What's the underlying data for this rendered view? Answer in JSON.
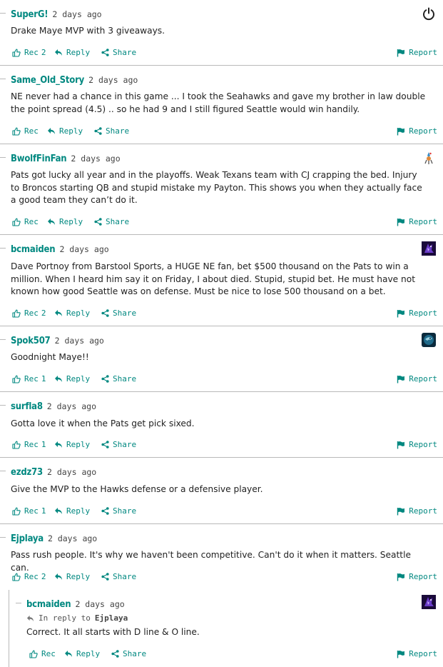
{
  "actions": {
    "rec": "Rec",
    "reply": "Reply",
    "share": "Share",
    "report": "Report"
  },
  "in_reply_to_label": "In reply to",
  "comments": [
    {
      "author": "SuperG!",
      "time": "2 days ago",
      "text": "Drake Maye MVP with 3 giveaways.",
      "rec_count": "2",
      "avatar": "power-icon"
    },
    {
      "author": "Same_Old_Story",
      "time": "2 days ago",
      "text": "NE never had a chance in this game ... I took the Seahawks and gave my brother in law double the point spread (4.5) .. so he had 9 and I still figured Seattle would win handily.",
      "rec_count": ""
    },
    {
      "author": "BwolfFinFan",
      "time": "2 days ago",
      "text": "Pats got lucky all year and in the playoffs. Weak Texans team with CJ crapping the bed. Injury to Broncos starting QB and stupid mistake my Payton. This shows you when they actually face a good team they can’t do it.",
      "rec_count": "",
      "avatar": "mascot-avatar"
    },
    {
      "author": "bcmaiden",
      "time": "2 days ago",
      "text": "Dave Portnoy from Barstool Sports, a HUGE NE fan, bet $500 thousand on the Pats to win a million. When I heard him say it on Friday, I about died. Stupid, stupid bet. He must have not known how good Seattle was on defense. Must be nice to lose 500 thousand on a bet.",
      "rec_count": "2",
      "avatar": "purple-avatar"
    },
    {
      "author": "Spok507",
      "time": "2 days ago",
      "text": "Goodnight Maye!!",
      "rec_count": "1",
      "avatar": "seahawks-avatar"
    },
    {
      "author": "surfla8",
      "time": "2 days ago",
      "text": "Gotta love it when the Pats get pick sixed.",
      "rec_count": "1"
    },
    {
      "author": "ezdz73",
      "time": "2 days ago",
      "text": "Give the MVP to the Hawks defense or a defensive player.",
      "rec_count": "1"
    },
    {
      "author": "Ejplaya",
      "time": "2 days ago",
      "text": "Pass rush people. It's why we haven't been competitive. Can't do it when it matters. Seattle can.",
      "rec_count": "2"
    },
    {
      "author": "bcmaiden",
      "time": "2 days ago",
      "text": "Correct. It all starts with D line & O line.",
      "rec_count": "",
      "in_reply_to": "Ejplaya",
      "avatar": "purple-avatar"
    }
  ],
  "colors": {
    "accent": "#008880",
    "divider": "#b9b9b9",
    "text": "#222222"
  }
}
